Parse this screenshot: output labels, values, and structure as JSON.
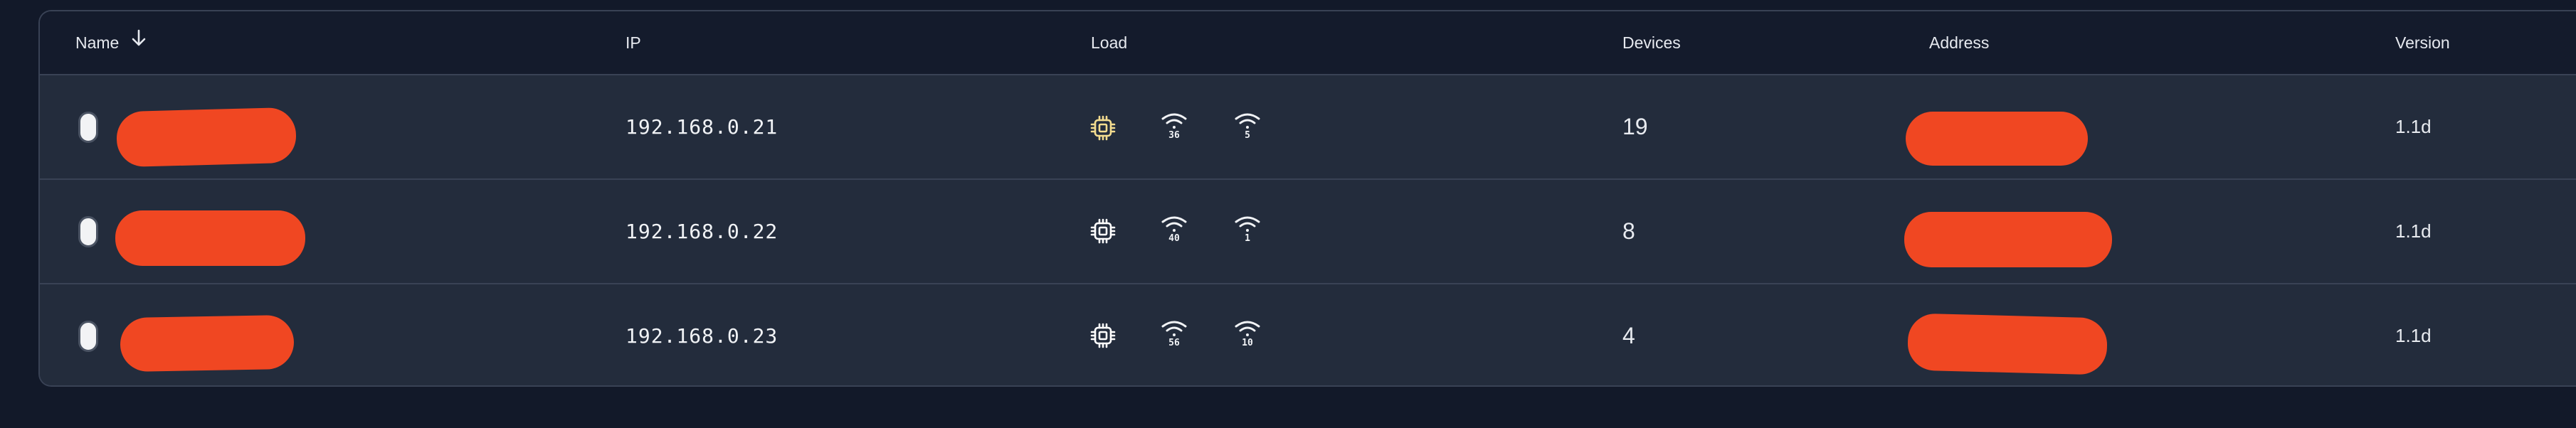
{
  "table": {
    "headers": {
      "name": "Name",
      "ip": "IP",
      "load": "Load",
      "devices": "Devices",
      "address": "Address",
      "version": "Version"
    },
    "sort_icon": "arrow-down-icon",
    "rows": [
      {
        "ip": "192.168.0.21",
        "cpu_icon": "cpu-chip-icon",
        "cpu_color": "#f3dc8f",
        "wifi_a": "36",
        "wifi_b": "5",
        "devices": "19",
        "version": "1.1d"
      },
      {
        "ip": "192.168.0.22",
        "cpu_icon": "cpu-chip-icon",
        "cpu_color": "#ffffff",
        "wifi_a": "40",
        "wifi_b": "1",
        "devices": "8",
        "version": "1.1d"
      },
      {
        "ip": "192.168.0.23",
        "cpu_icon": "cpu-chip-icon",
        "cpu_color": "#ffffff",
        "wifi_a": "56",
        "wifi_b": "10",
        "devices": "4",
        "version": "1.1d"
      }
    ]
  },
  "colors": {
    "redaction": "#f04722",
    "background": "#121929",
    "row": "#232c3c",
    "header": "#141b2c"
  }
}
